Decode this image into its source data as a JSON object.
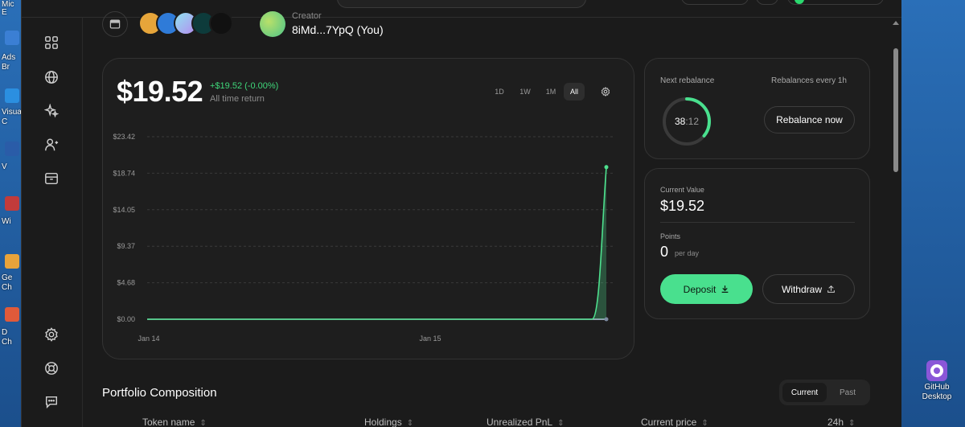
{
  "desktop": {
    "side_labels": [
      "Mic",
      "E",
      "Ads",
      "Br",
      "Visua",
      "C",
      "V",
      "Wi",
      "Ge",
      "Ch",
      "D",
      "Ch"
    ],
    "github": {
      "line1": "GitHub",
      "line2": "Desktop"
    }
  },
  "header": {
    "creator_label": "Creator",
    "creator_name": "8iMd...7YpQ (You)"
  },
  "summary": {
    "value": "$19.52",
    "change": "+$19.52 (-0.00%)",
    "change_label": "All time return",
    "ranges": [
      "1D",
      "1W",
      "1M",
      "All"
    ],
    "active_range": "All"
  },
  "chart_data": {
    "type": "area",
    "x_tick_labels": [
      "Jan 14",
      "Jan 15"
    ],
    "y_tick_labels": [
      "$23.42",
      "$18.74",
      "$14.05",
      "$9.37",
      "$4.68",
      "$0.00"
    ],
    "ylim": [
      0,
      23.42
    ],
    "x": [
      "Jan 14",
      "Jan 15",
      "Jan 15 (latest-1)",
      "Jan 15 (latest)"
    ],
    "values": [
      0,
      0,
      0,
      19.52
    ],
    "series_color": "#4ee08e",
    "grid": "dashed horizontal"
  },
  "rebalance": {
    "title": "Next rebalance",
    "every": "Rebalances every 1h",
    "timer_minutes": "38",
    "timer_sep": ":",
    "timer_seconds": "12",
    "progress_fraction": 0.36,
    "button": "Rebalance now"
  },
  "value_card": {
    "current_label": "Current Value",
    "current_value": "$19.52",
    "points_label": "Points",
    "points_value": "0",
    "points_unit": "per day",
    "deposit": "Deposit",
    "withdraw": "Withdraw"
  },
  "portfolio": {
    "title": "Portfolio Composition",
    "tabs": [
      "Current",
      "Past"
    ],
    "active_tab": "Current",
    "columns": [
      "Token name",
      "Holdings",
      "Unrealized PnL",
      "Current price",
      "24h"
    ]
  },
  "colors": {
    "accent": "#49e08e",
    "background": "#1b1b1b",
    "card": "#1e1e1e",
    "positive": "#3fd77a"
  }
}
